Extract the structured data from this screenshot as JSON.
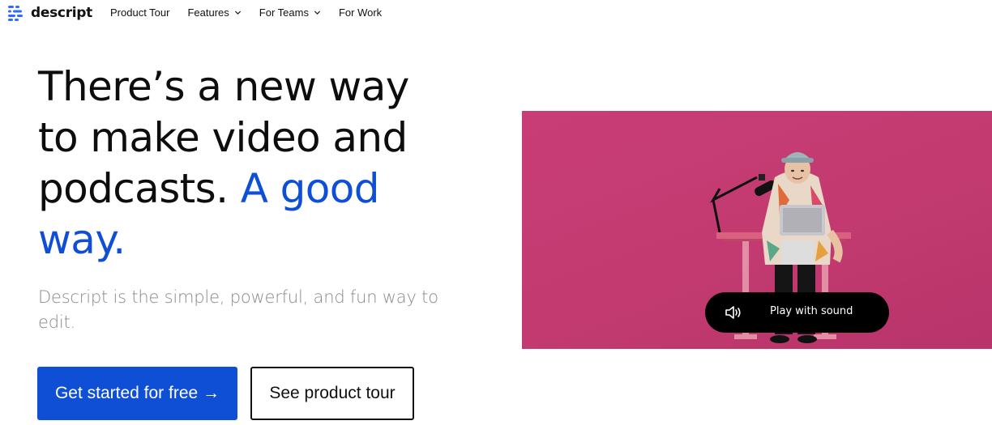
{
  "brand": {
    "name": "descript",
    "color": "#2f6bff"
  },
  "nav": {
    "items": [
      {
        "label": "Product Tour",
        "has_dropdown": false
      },
      {
        "label": "Features",
        "has_dropdown": true
      },
      {
        "label": "For Teams",
        "has_dropdown": true
      },
      {
        "label": "For Work",
        "has_dropdown": false
      }
    ]
  },
  "hero": {
    "headline_main": "There’s a new way to make video and podcasts. ",
    "headline_accent": "A good way.",
    "subtitle": "Descript is the simple, powerful, and fun way to edit.",
    "accent_color": "#0f4fd6"
  },
  "cta": {
    "primary_label": "Get started for free →",
    "secondary_label": "See product tour"
  },
  "video": {
    "background_color": "#c93d77",
    "play_label": "Play with sound",
    "icon": "speaker-icon"
  }
}
